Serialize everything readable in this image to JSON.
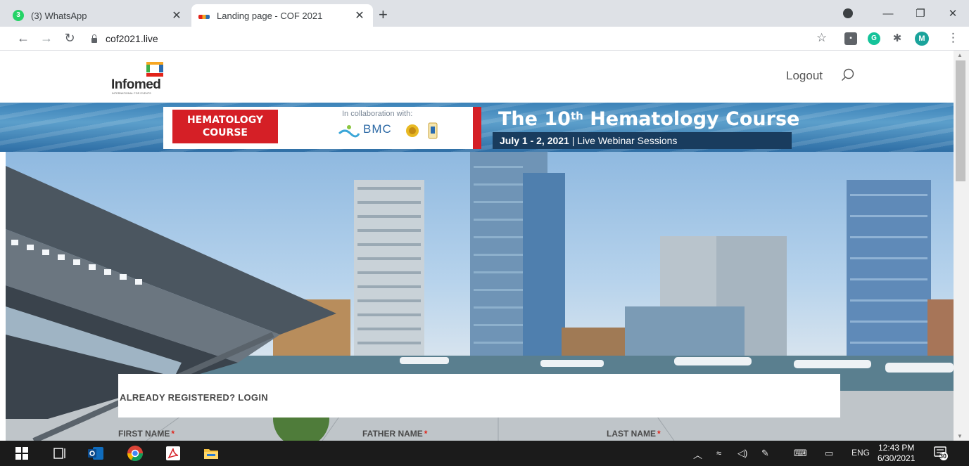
{
  "browser": {
    "tabs": [
      {
        "title": "(3) WhatsApp",
        "badge": "3",
        "active": false
      },
      {
        "title": "Landing page - COF 2021",
        "active": true
      }
    ],
    "url": "cof2021.live",
    "profile_initial": "M",
    "grammarly_initial": "G"
  },
  "site": {
    "logo_text": "Infomed",
    "logo_subtitle": "INTERNATIONAL FOR EVENTS",
    "logout_label": "Logout"
  },
  "banner": {
    "course_label_line1": "HEMATOLOGY",
    "course_label_line2": "COURSE",
    "collab_text": "In collaboration with:",
    "partner_text": "BMC",
    "title_prefix": "The 10",
    "title_sup": "th",
    "title_suffix": " Hematology Course",
    "dates": "July 1 - 2, 2021",
    "separator": " | ",
    "session_type": "Live Webinar Sessions"
  },
  "login": {
    "title": "ALREADY REGISTERED? LOGIN",
    "fields": [
      {
        "label": "FIRST NAME",
        "required_mark": "*"
      },
      {
        "label": "FATHER NAME",
        "required_mark": "*"
      },
      {
        "label": "LAST NAME",
        "required_mark": "*"
      }
    ]
  },
  "taskbar": {
    "language": "ENG",
    "time": "12:43 PM",
    "date": "6/30/2021",
    "notification_count": "30"
  },
  "colors": {
    "brand_red": "#d51f26",
    "banner_blue": "#193c5e",
    "required_red": "#e0241a"
  }
}
